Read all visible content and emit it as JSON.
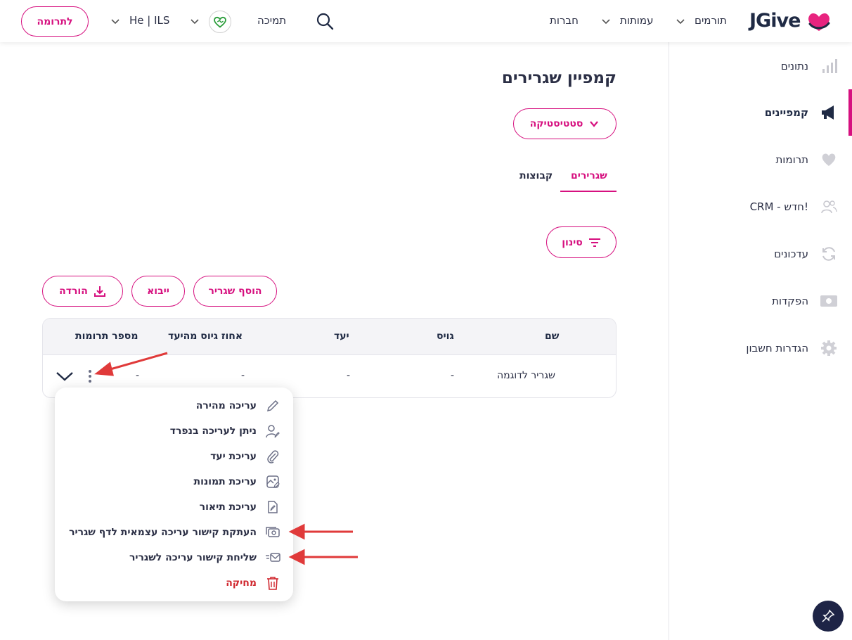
{
  "header": {
    "logo": "JGive",
    "nav": {
      "donors": "תורמים",
      "associations": "עמותות",
      "companies": "חברות",
      "support": "תמיכה",
      "lang_currency": "He | ILS"
    },
    "donate_button": "לתרומה"
  },
  "sidebar": {
    "items": [
      {
        "label": "נתונים",
        "icon": "bar-chart-icon"
      },
      {
        "label": "קמפיינים",
        "icon": "megaphone-icon",
        "active": true
      },
      {
        "label": "תרומות",
        "icon": "heart-icon"
      },
      {
        "label": "CRM - חדש!",
        "icon": "users-icon"
      },
      {
        "label": "עדכונים",
        "icon": "refresh-icon"
      },
      {
        "label": "הפקדות",
        "icon": "banknote-icon"
      },
      {
        "label": "הגדרות חשבון",
        "icon": "gear-icon"
      }
    ]
  },
  "main": {
    "title": "קמפיין שגרירים",
    "stats_button": "סטטיסטיקה",
    "tabs": [
      {
        "label": "שגרירים",
        "active": true
      },
      {
        "label": "קבוצות",
        "active": false
      }
    ],
    "filter_button": "סינון",
    "actions": {
      "add": "הוסף שגריר",
      "import": "ייבוא",
      "download": "הורדה"
    },
    "table": {
      "columns": [
        "שם",
        "גויס",
        "יעד",
        "אחוז גיוס מהיעד",
        "מספר תרומות"
      ],
      "rows": [
        [
          "שגריר לדוגמה",
          "-",
          "-",
          "-",
          "-"
        ]
      ]
    }
  },
  "menu": {
    "items": [
      {
        "label": "עריכה מהירה",
        "icon": "pencil-icon"
      },
      {
        "label": "ניתן לעריכה בנפרד",
        "icon": "user-edit-icon"
      },
      {
        "label": "עריכת יעד",
        "icon": "paperclip-icon"
      },
      {
        "label": "עריכת תמונות",
        "icon": "image-edit-icon"
      },
      {
        "label": "עריכת תיאור",
        "icon": "file-edit-icon"
      },
      {
        "label": "העתקת קישור עריכה עצמאית לדף שגריר",
        "icon": "copy-link-icon"
      },
      {
        "label": "שליחת קישור עריכה לשגריר",
        "icon": "mail-send-icon"
      },
      {
        "label": "מחיקה",
        "icon": "trash-icon",
        "danger": true
      }
    ]
  },
  "colors": {
    "brand": "#d6107f",
    "navy": "#1e2446",
    "danger": "#d0272e",
    "annotation": "#e03a3a"
  }
}
